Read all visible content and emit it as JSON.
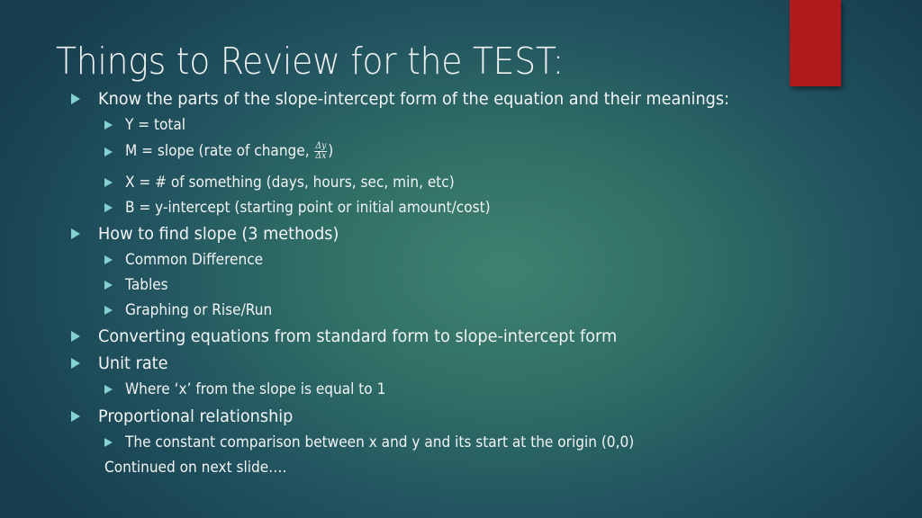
{
  "slide": {
    "title": "Things to Review for the TEST:",
    "accent_color": "#b01a1a",
    "bullet_icon": "triangle-right-icon",
    "items": [
      {
        "level": 1,
        "text": "Know the parts of the slope-intercept form of the equation and their meanings:"
      },
      {
        "level": 2,
        "text": "Y = total"
      },
      {
        "level": 2,
        "text_before": "M = slope (rate of change, ",
        "fraction_numerator": "Δy",
        "fraction_denominator": "Δx",
        "text_after": ")"
      },
      {
        "level": 2,
        "text": "X = # of something (days, hours, sec, min, etc)"
      },
      {
        "level": 2,
        "text": "B = y-intercept (starting point or initial amount/cost)"
      },
      {
        "level": 1,
        "text": "How to find slope (3 methods)"
      },
      {
        "level": 2,
        "text": "Common Difference"
      },
      {
        "level": 2,
        "text": "Tables"
      },
      {
        "level": 2,
        "text": "Graphing or Rise/Run"
      },
      {
        "level": 1,
        "text": "Converting equations from standard form to slope-intercept form"
      },
      {
        "level": 1,
        "text": "Unit rate"
      },
      {
        "level": 2,
        "text": "Where ‘x’ from the slope is equal to 1"
      },
      {
        "level": 1,
        "text": "Proportional relationship"
      },
      {
        "level": 2,
        "text": "The constant comparison between x and y and its start at the origin (0,0)"
      }
    ],
    "footer_note": "Continued on next slide…."
  }
}
